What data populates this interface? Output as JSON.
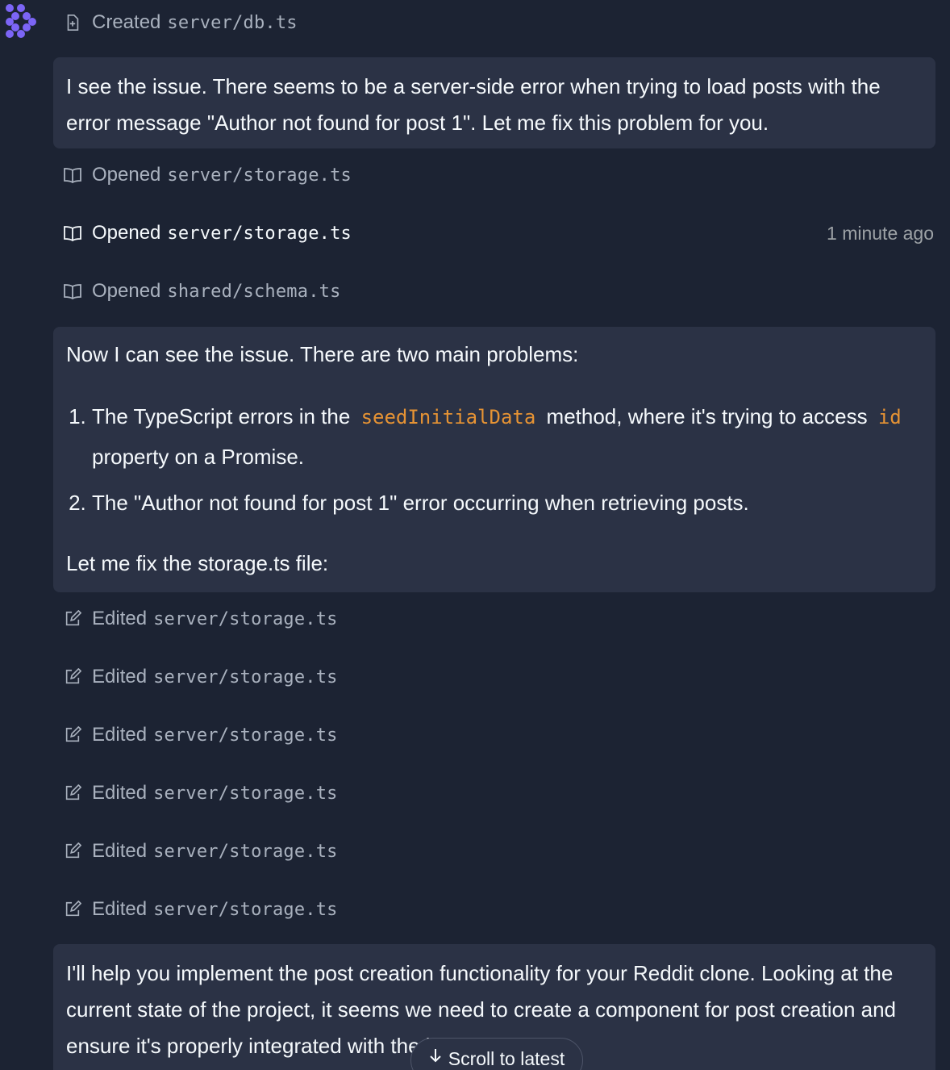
{
  "agent": {
    "avatar_icon": "agent-logo-icon",
    "accent": "#7c65f6"
  },
  "log": {
    "created": {
      "icon": "file-plus-icon",
      "verb": "Created",
      "path": "server/db.ts"
    },
    "opened": [
      {
        "icon": "book-open-icon",
        "verb": "Opened",
        "path": "server/storage.ts"
      },
      {
        "icon": "book-open-icon",
        "verb": "Opened",
        "path": "server/storage.ts",
        "time": "1 minute ago"
      },
      {
        "icon": "book-open-icon",
        "verb": "Opened",
        "path": "shared/schema.ts"
      }
    ],
    "edited": [
      {
        "icon": "edit-icon",
        "verb": "Edited",
        "path": "server/storage.ts"
      },
      {
        "icon": "edit-icon",
        "verb": "Edited",
        "path": "server/storage.ts"
      },
      {
        "icon": "edit-icon",
        "verb": "Edited",
        "path": "server/storage.ts"
      },
      {
        "icon": "edit-icon",
        "verb": "Edited",
        "path": "server/storage.ts"
      },
      {
        "icon": "edit-icon",
        "verb": "Edited",
        "path": "server/storage.ts"
      },
      {
        "icon": "edit-icon",
        "verb": "Edited",
        "path": "server/storage.ts"
      }
    ]
  },
  "messages": {
    "m1": {
      "text": "I see the issue. There seems to be a server-side error when trying to load posts with the error message \"Author not found for post 1\". Let me fix this problem for you."
    },
    "m2": {
      "intro": "Now I can see the issue. There are two main problems:",
      "item1_a": "The TypeScript errors in the",
      "item1_code1": "seedInitialData",
      "item1_b": "method, where it's trying to access",
      "item1_code2": "id",
      "item1_c": "property on a Promise.",
      "item2": "The \"Author not found for post 1\" error occurring when retrieving posts.",
      "outro": "Let me fix the storage.ts file:"
    },
    "m3": {
      "text": "I'll help you implement the post creation functionality for your Reddit clone. Looking at the current state of the project, it seems we need to create a component for post creation and ensure it's properly integrated with the backend."
    }
  },
  "scroll_button": {
    "icon": "arrow-down-icon",
    "label": "Scroll to latest"
  },
  "colors": {
    "background": "#1c2333",
    "bubble": "#2b3245",
    "muted_text": "#a9b1be",
    "code": "#e69334"
  }
}
